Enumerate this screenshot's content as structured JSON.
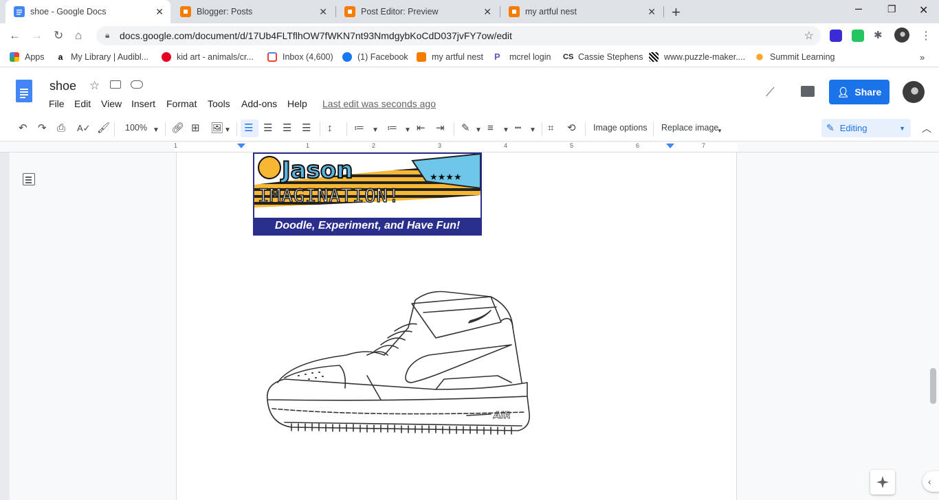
{
  "browser": {
    "tabs": [
      {
        "title": "shoe - Google Docs",
        "icon": "google-docs-icon",
        "active": true
      },
      {
        "title": "Blogger: Posts",
        "icon": "blogger-icon",
        "active": false
      },
      {
        "title": "Post Editor: Preview",
        "icon": "blogger-icon",
        "active": false
      },
      {
        "title": "my artful nest",
        "icon": "blogger-icon",
        "active": false
      }
    ],
    "url": "docs.google.com/document/d/17Ub4FLTflhOW7fWKN7nt93NmdgybKoCdD037jvFY7ow/edit",
    "bookmarks": [
      {
        "label": "Apps",
        "icon": "apps-grid-icon"
      },
      {
        "label": "My Library | Audibl...",
        "icon": "amazon-icon"
      },
      {
        "label": "kid art - animals/cr...",
        "icon": "pinterest-icon"
      },
      {
        "label": "Inbox (4,600)",
        "icon": "gmail-icon"
      },
      {
        "label": "(1) Facebook",
        "icon": "facebook-icon"
      },
      {
        "label": "my artful nest",
        "icon": "blogger-icon"
      },
      {
        "label": "mcrel login",
        "icon": "mcrel-icon"
      },
      {
        "label": "Cassie Stephens",
        "icon": "cs-icon"
      },
      {
        "label": "www.puzzle-maker....",
        "icon": "puzzle-icon"
      },
      {
        "label": "Summit Learning",
        "icon": "sun-icon"
      }
    ]
  },
  "docs": {
    "title": "shoe",
    "menus": [
      "File",
      "Edit",
      "View",
      "Insert",
      "Format",
      "Tools",
      "Add-ons",
      "Help"
    ],
    "last_edit": "Last edit was seconds ago",
    "share_label": "Share",
    "zoom": "100%",
    "image_options": "Image options",
    "replace_image": "Replace image",
    "mode": "Editing",
    "ruler_numbers": [
      "1",
      "1",
      "2",
      "3",
      "4",
      "5",
      "6",
      "7"
    ]
  },
  "document": {
    "banner_tagline": "Doodle, Experiment, and Have Fun!",
    "banner_word": "IMAGINATION!",
    "banner_name": "Jason",
    "shoe_brand_text": "AIR"
  },
  "colors": {
    "accent": "#1a73e8",
    "banner_blue": "#2b2f8c"
  }
}
